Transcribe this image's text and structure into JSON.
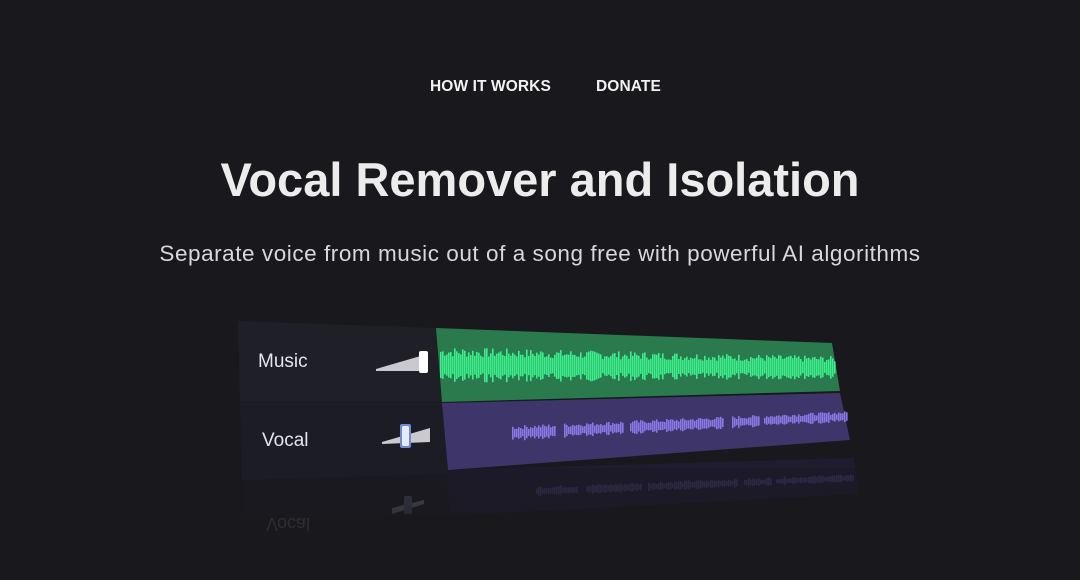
{
  "nav": {
    "items": [
      {
        "label": "HOW IT WORKS"
      },
      {
        "label": "DONATE"
      }
    ]
  },
  "hero": {
    "title": "Vocal Remover and Isolation",
    "subtitle": "Separate voice from music out of a song free with powerful AI algorithms"
  },
  "mixer": {
    "tracks": [
      {
        "label": "Music",
        "color": "#2a7a4e",
        "wave_color": "#3cf08c",
        "volume": 1.0
      },
      {
        "label": "Vocal",
        "color": "#3e356a",
        "wave_color": "#8a78e6",
        "volume": 0.6
      }
    ],
    "reflection_label": "Vocal"
  },
  "colors": {
    "background": "#18181d",
    "panel": "#1f1f27"
  }
}
